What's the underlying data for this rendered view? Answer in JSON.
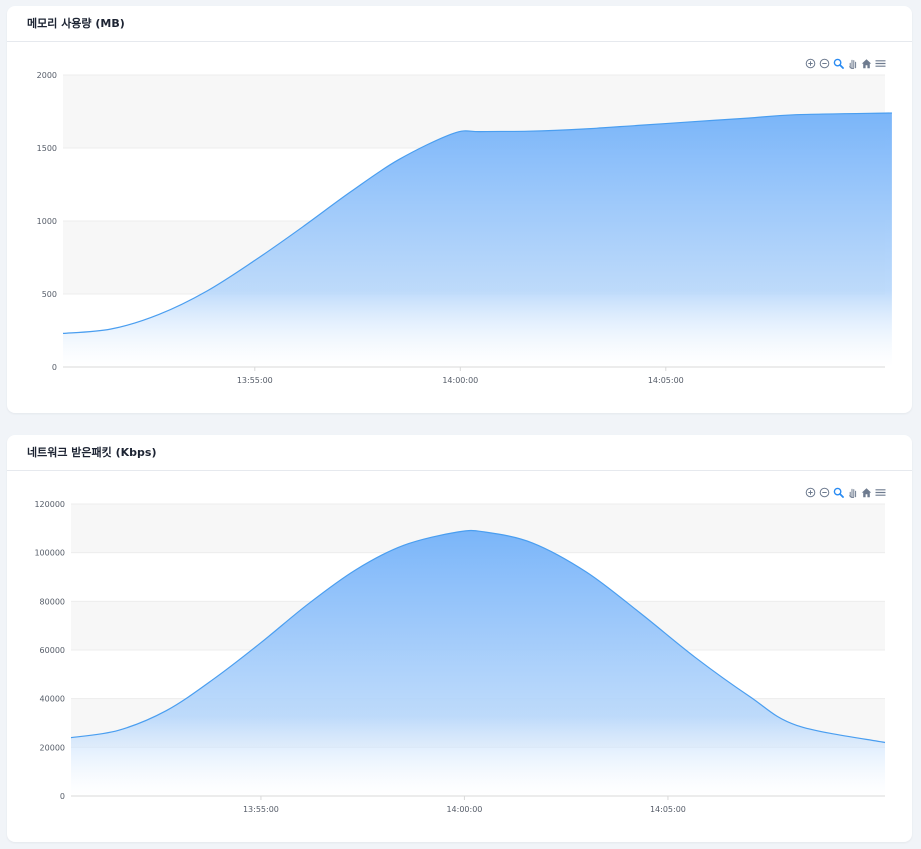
{
  "colors": {
    "page_bg": "#f1f4f8",
    "card_bg": "#ffffff",
    "area_top": "#7ab5f9",
    "area_bottom": "#ffffff",
    "line": "#4a9ef0",
    "grid_band": "#f7f7f7",
    "icon": "#6e7b8f",
    "icon_active": "#2a8bf2"
  },
  "toolbar": {
    "icons": [
      "zoom-in-icon",
      "zoom-out-icon",
      "selection-zoom-icon",
      "pan-hand-icon",
      "home-reset-icon",
      "menu-icon"
    ]
  },
  "charts": [
    {
      "title": "메모리 사용량 (MB)"
    },
    {
      "title": "네트워크 받은패킷 (Kbps)"
    }
  ],
  "chart_data": [
    {
      "type": "area",
      "title": "메모리 사용량 (MB)",
      "xlabel": "",
      "ylabel": "",
      "ylim": [
        0,
        2000
      ],
      "y_ticks": [
        "0",
        "500",
        "1000",
        "1500",
        "2000"
      ],
      "x_ticks": [
        "13:55:00",
        "14:00:00",
        "14:05:00"
      ],
      "grid": true,
      "x": [
        "13:50:20",
        "13:51:30",
        "13:52:40",
        "13:53:50",
        "13:55:00",
        "13:56:10",
        "13:57:20",
        "13:58:30",
        "13:59:50",
        "14:00:30",
        "14:01:40",
        "14:03:00",
        "14:04:20",
        "14:05:40",
        "14:07:00",
        "14:08:10",
        "14:10:30"
      ],
      "series": [
        {
          "values": [
            230,
            260,
            360,
            520,
            730,
            960,
            1200,
            1420,
            1600,
            1612,
            1615,
            1630,
            1655,
            1680,
            1705,
            1728,
            1740
          ]
        }
      ]
    },
    {
      "type": "area",
      "title": "네트워크 받은패킷 (Kbps)",
      "xlabel": "",
      "ylabel": "",
      "ylim": [
        0,
        120000
      ],
      "y_ticks": [
        "0",
        "20000",
        "40000",
        "60000",
        "80000",
        "100000",
        "120000"
      ],
      "x_ticks": [
        "13:55:00",
        "14:00:00",
        "14:05:00"
      ],
      "grid": true,
      "x": [
        "13:50:20",
        "13:51:30",
        "13:52:40",
        "13:53:50",
        "13:55:00",
        "13:56:10",
        "13:57:20",
        "13:58:30",
        "13:59:50",
        "14:00:30",
        "14:01:40",
        "14:03:00",
        "14:04:20",
        "14:05:40",
        "14:07:00",
        "14:08:10",
        "14:10:20"
      ],
      "series": [
        {
          "values": [
            24000,
            27000,
            35000,
            48000,
            63000,
            79000,
            93000,
            103000,
            108500,
            108500,
            104000,
            92000,
            75000,
            57000,
            41000,
            29000,
            22000
          ]
        }
      ]
    }
  ]
}
